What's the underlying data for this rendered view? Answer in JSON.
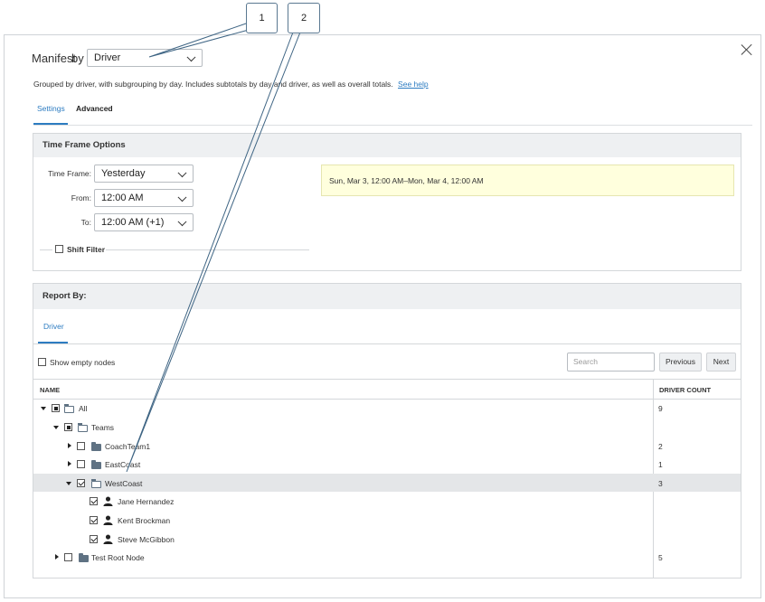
{
  "header": {
    "manifest_label": "Manifest",
    "by_label": "by",
    "report_type_value": "Driver",
    "description": "Grouped by driver, with subgrouping by day. Includes subtotals by day and driver, as well as overall totals.",
    "help_link": "See help"
  },
  "tabs": {
    "settings": "Settings",
    "advanced": "Advanced"
  },
  "time_frame": {
    "title": "Time Frame Options",
    "time_frame_label": "Time Frame:",
    "time_frame_value": "Yesterday",
    "from_label": "From:",
    "from_value": "12:00 AM",
    "to_label": "To:",
    "to_value": "12:00 AM (+1)",
    "shift_filter_label": "Shift Filter",
    "range_text": "Sun, Mar 3, 12:00 AM–Mon, Mar 4, 12:00 AM"
  },
  "report_by": {
    "title": "Report By:",
    "tab_driver": "Driver",
    "show_empty_label": "Show empty nodes",
    "search_placeholder": "Search",
    "previous_label": "Previous",
    "next_label": "Next",
    "col_name": "NAME",
    "col_count": "DRIVER COUNT",
    "rows": [
      {
        "name": "All",
        "count": "9"
      },
      {
        "name": "Teams",
        "count": ""
      },
      {
        "name": "CoachTeam1",
        "count": "2"
      },
      {
        "name": "EastCoast",
        "count": "1"
      },
      {
        "name": "WestCoast",
        "count": "3"
      },
      {
        "name": "Jane Hernandez",
        "count": ""
      },
      {
        "name": "Kent Brockman",
        "count": ""
      },
      {
        "name": "Steve McGibbon",
        "count": ""
      },
      {
        "name": "Test Root Node",
        "count": "5"
      }
    ]
  },
  "callouts": {
    "one": "1",
    "two": "2"
  },
  "colors": {
    "accent": "#2d7cc1",
    "highlight_row": "#e4e6e8",
    "date_box": "#ffffdd"
  }
}
